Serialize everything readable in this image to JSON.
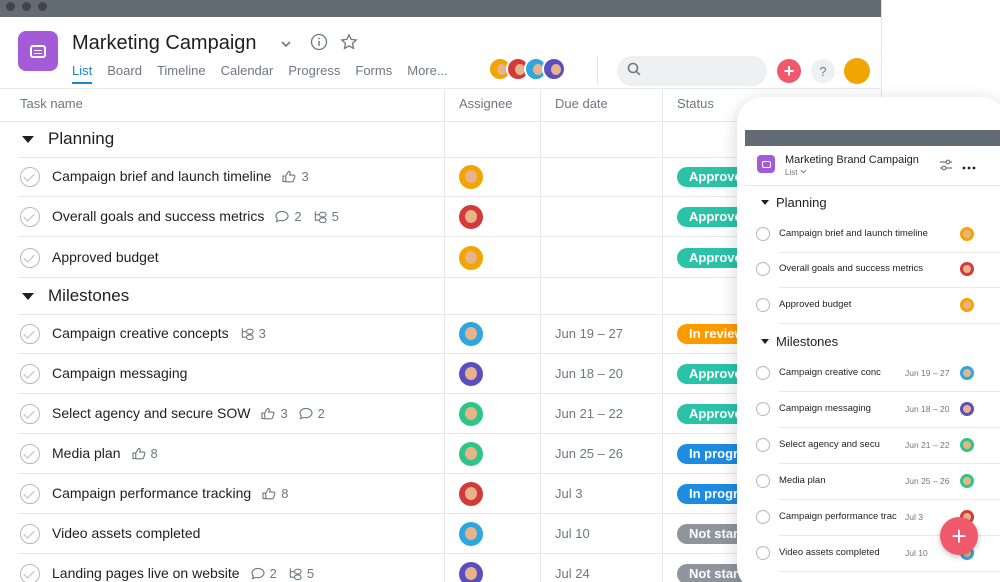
{
  "project": {
    "title": "Marketing Campaign",
    "tabs": [
      "List",
      "Board",
      "Timeline",
      "Calendar",
      "Progress",
      "Forms",
      "More..."
    ]
  },
  "header": {
    "help_label": "?",
    "add_label": "+"
  },
  "columns": {
    "task": "Task name",
    "assignee": "Assignee",
    "due": "Due date",
    "status": "Status"
  },
  "sections": [
    {
      "name": "Planning"
    },
    {
      "name": "Milestones"
    }
  ],
  "tasks": [
    {
      "name": "Campaign brief and launch timeline",
      "likes": "3",
      "comments": "",
      "subtasks": "",
      "due": "",
      "status": "Approved",
      "status_color": "#2ac3a7",
      "avatar_color": "#f0a500"
    },
    {
      "name": "Overall goals and success metrics",
      "likes": "",
      "comments": "2",
      "subtasks": "5",
      "due": "",
      "status": "Approved",
      "status_color": "#2ac3a7",
      "avatar_color": "#d33a3a"
    },
    {
      "name": "Approved budget",
      "likes": "",
      "comments": "",
      "subtasks": "",
      "due": "",
      "status": "Approved",
      "status_color": "#2ac3a7",
      "avatar_color": "#f0a500"
    },
    {
      "name": "Campaign creative concepts",
      "likes": "",
      "comments": "",
      "subtasks": "3",
      "due": "Jun 19 – 27",
      "status": "In review",
      "status_color": "#fd9a00",
      "avatar_color": "#2ea6e0"
    },
    {
      "name": "Campaign messaging",
      "likes": "",
      "comments": "",
      "subtasks": "",
      "due": "Jun 18 – 20",
      "status": "Approved",
      "status_color": "#2ac3a7",
      "avatar_color": "#5a4fc0"
    },
    {
      "name": "Select agency and secure SOW",
      "likes": "3",
      "comments": "2",
      "subtasks": "",
      "due": "Jun 21 – 22",
      "status": "Approved",
      "status_color": "#2ac3a7",
      "avatar_color": "#2ec586"
    },
    {
      "name": "Media plan",
      "likes": "8",
      "comments": "",
      "subtasks": "",
      "due": "Jun 25 – 26",
      "status": "In progress",
      "status_color": "#1d8be0",
      "avatar_color": "#2ec586"
    },
    {
      "name": "Campaign performance tracking",
      "likes": "8",
      "comments": "",
      "subtasks": "",
      "due": "Jul 3",
      "status": "In progress",
      "status_color": "#1d8be0",
      "avatar_color": "#d33a3a"
    },
    {
      "name": "Video assets completed",
      "likes": "",
      "comments": "",
      "subtasks": "",
      "due": "Jul 10",
      "status": "Not started",
      "status_color": "#8e959c",
      "avatar_color": "#2ea6e0"
    },
    {
      "name": "Landing pages live on website",
      "likes": "",
      "comments": "2",
      "subtasks": "5",
      "due": "Jul 24",
      "status": "Not started",
      "status_color": "#8e959c",
      "avatar_color": "#5a4fc0"
    }
  ],
  "mobile": {
    "title": "Marketing Brand Campaign",
    "view": "List",
    "sections": [
      "Planning",
      "Milestones"
    ],
    "tasks": [
      {
        "name": "Campaign brief and launch timeline",
        "due": ""
      },
      {
        "name": "Overall goals and success metrics",
        "due": ""
      },
      {
        "name": "Approved budget",
        "due": ""
      },
      {
        "name": "Campaign creative conc",
        "due": "Jun 19 – 27"
      },
      {
        "name": "Campaign messaging",
        "due": "Jun 18 – 20"
      },
      {
        "name": "Select agency and secu",
        "due": "Jun 21 – 22"
      },
      {
        "name": "Media plan",
        "due": "Jun 25 – 26"
      },
      {
        "name": "Campaign performance track",
        "due": "Jul 3"
      },
      {
        "name": "Video assets completed",
        "due": "Jul 10"
      }
    ],
    "fab_label": "+"
  },
  "colors": {
    "accent": "#1d83d3",
    "project_icon": "#a35bd8",
    "add_button": "#f0596c"
  },
  "icons": [
    "list-icon",
    "chevron-down-icon",
    "info-icon",
    "star-icon",
    "search-icon",
    "like-icon",
    "comment-icon",
    "subtask-icon",
    "checkmark-icon",
    "filter-icon",
    "more-icon"
  ]
}
